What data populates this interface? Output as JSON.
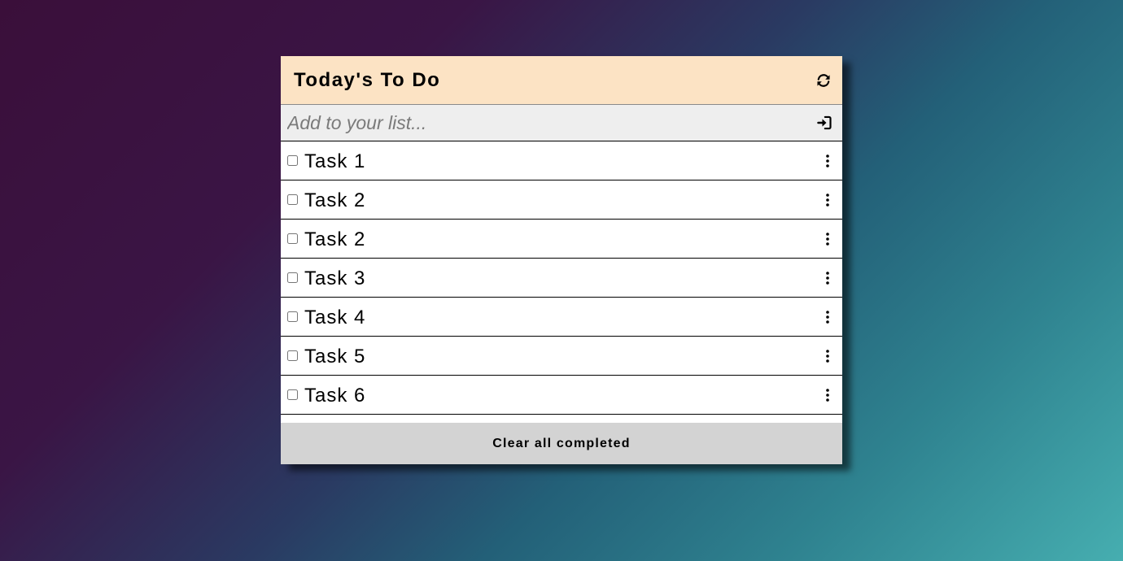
{
  "header": {
    "title": "Today's To Do",
    "refresh_icon": "refresh-icon"
  },
  "add": {
    "placeholder": "Add to your list...",
    "value": "",
    "submit_icon": "sign-in-icon"
  },
  "tasks": [
    {
      "label": "Task 1",
      "checked": false
    },
    {
      "label": "Task 2",
      "checked": false
    },
    {
      "label": "Task 2",
      "checked": false
    },
    {
      "label": "Task 3",
      "checked": false
    },
    {
      "label": "Task 4",
      "checked": false
    },
    {
      "label": "Task 5",
      "checked": false
    },
    {
      "label": "Task 6",
      "checked": false
    },
    {
      "label": "",
      "checked": false
    }
  ],
  "footer": {
    "clear_label": "Clear all completed"
  },
  "colors": {
    "header_bg": "#fce3c4",
    "input_bg": "#eeeeee",
    "footer_bg": "#d3d3d3",
    "card_bg": "#ffffff",
    "text": "#000000"
  }
}
